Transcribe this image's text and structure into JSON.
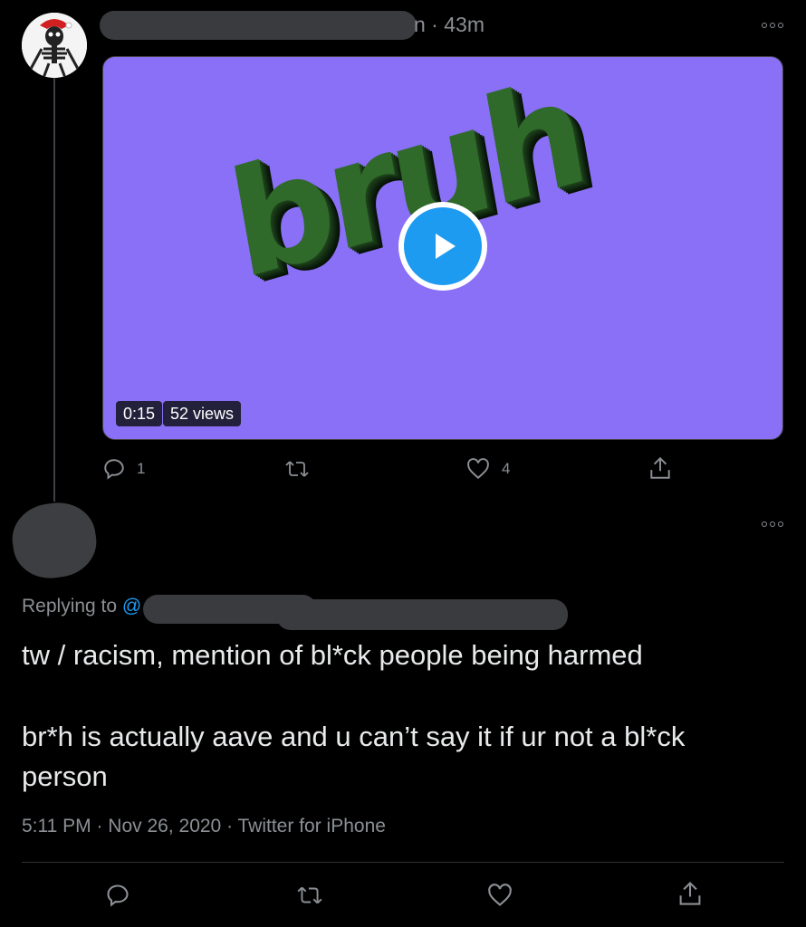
{
  "parent_tweet": {
    "time_suffix": "n · 43m",
    "video": {
      "overlay_text": "bruh",
      "duration": "0:15",
      "views": "52 views"
    },
    "actions": {
      "reply_count": "1",
      "retweet_count": "",
      "like_count": "4"
    }
  },
  "reply_tweet": {
    "replying_label": "Replying to",
    "replying_at": "@",
    "text_line_1": "tw / racism, mention of bl*ck people being harmed",
    "text_line_2": "br*h is actually aave and u can’t say it if ur not a bl*ck",
    "text_line_3": "person",
    "timestamp": "5:11 PM · Nov 26, 2020 · Twitter for iPhone"
  },
  "icons": [
    "more-icon",
    "play-icon",
    "reply-icon",
    "retweet-icon",
    "like-icon",
    "share-icon"
  ],
  "colors": {
    "background": "#000000",
    "accent": "#1d9bf0",
    "media_bg": "#8a6ff7",
    "muted": "#8b8f94"
  }
}
